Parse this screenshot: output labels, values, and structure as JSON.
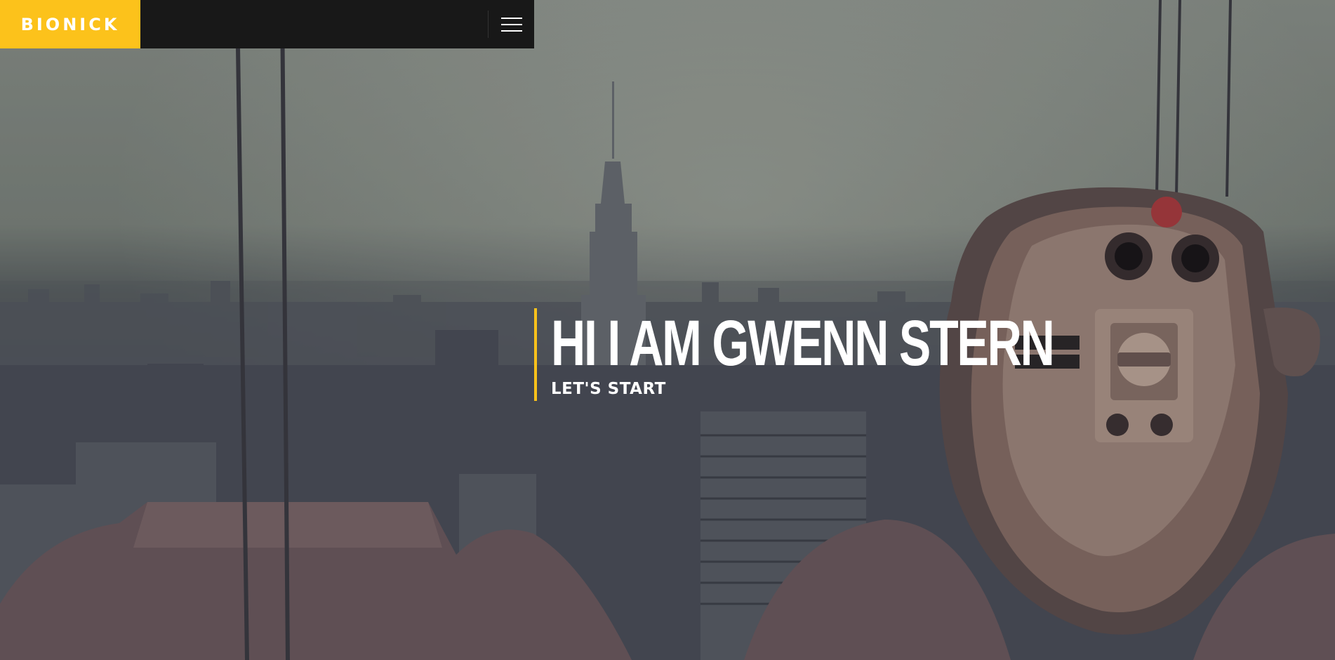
{
  "header": {
    "logo_text": "BIONICK",
    "menu_icon": "hamburger-menu-icon",
    "brand_color": "#fcc21b",
    "bar_color": "#181818"
  },
  "hero": {
    "headline": "HI I AM GWENN STERN",
    "subline": "LET'S START",
    "background_image": "city-skyline-with-binocular-viewer",
    "accent_color": "#fcc21b"
  }
}
